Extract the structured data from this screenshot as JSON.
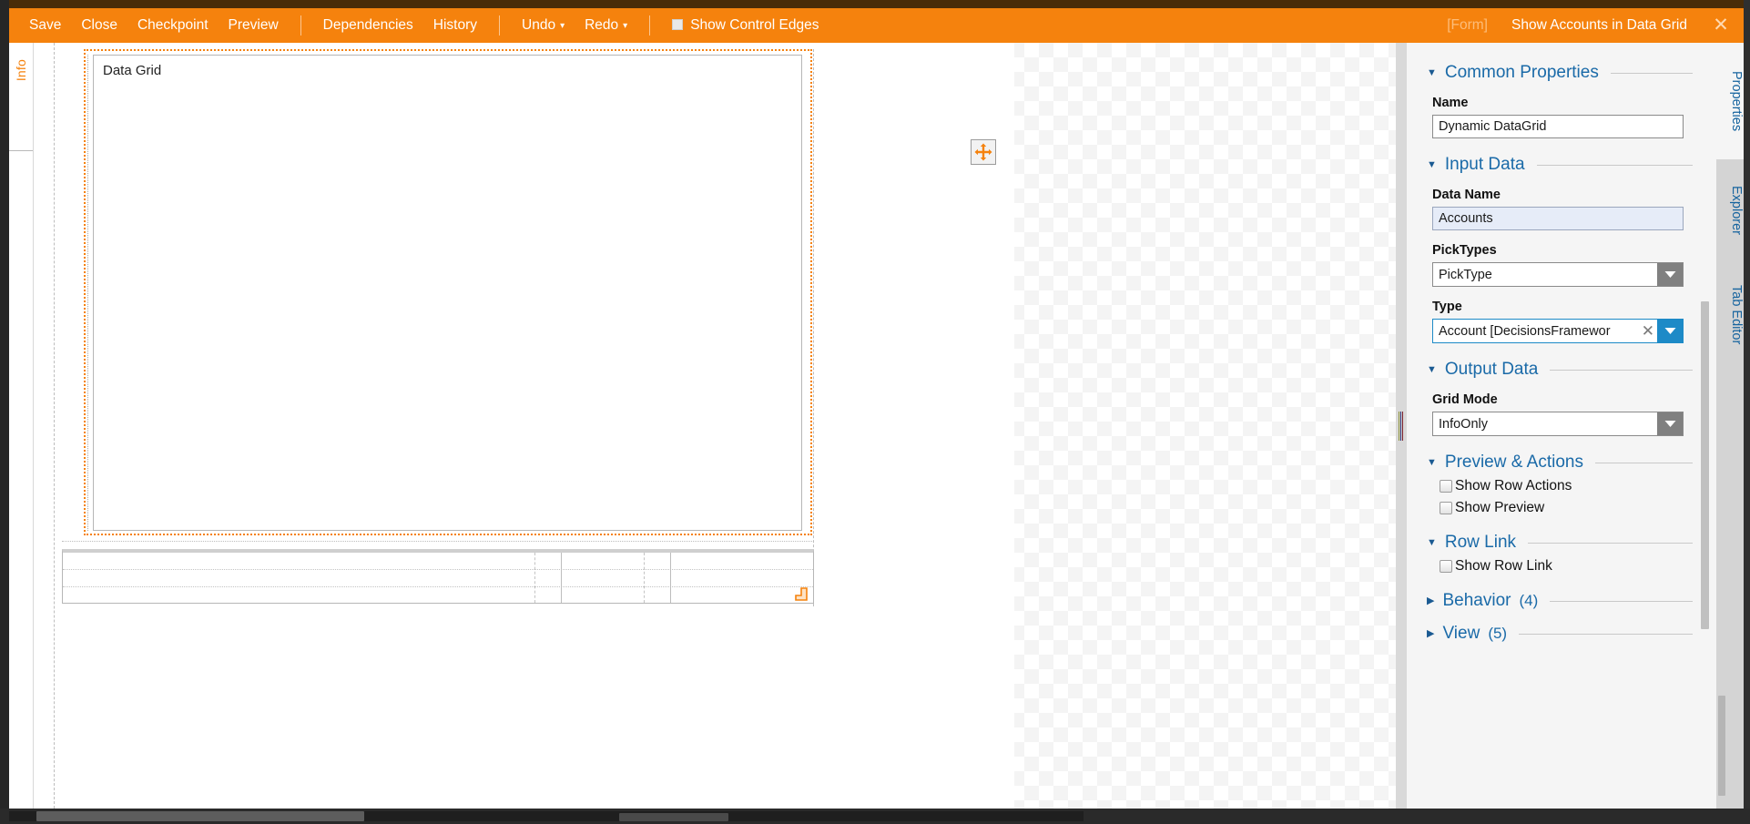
{
  "toolbar": {
    "items": [
      {
        "label": "Save",
        "name": "save"
      },
      {
        "label": "Close",
        "name": "close"
      },
      {
        "label": "Checkpoint",
        "name": "checkpoint"
      },
      {
        "label": "Preview",
        "name": "preview"
      },
      {
        "label": "Dependencies",
        "name": "dependencies"
      },
      {
        "label": "History",
        "name": "history"
      },
      {
        "label": "Undo",
        "name": "undo"
      },
      {
        "label": "Redo",
        "name": "redo"
      }
    ],
    "undo_label": "Undo",
    "redo_label": "Redo",
    "show_control_edges_label": "Show Control Edges",
    "show_control_edges_checked": false,
    "form_tag": "[Form]",
    "document_title": "Show Accounts in Data Grid",
    "close_glyph": "✕",
    "accent_color": "#f5820d"
  },
  "left_strip": {
    "info_tab_label": "Info"
  },
  "canvas": {
    "data_grid_label": "Data Grid",
    "move_handle_icon": "move-arrows-icon",
    "resize_handle_icon": "resize-corner-icon"
  },
  "properties": {
    "sections": {
      "common": {
        "title": "Common Properties",
        "expanded": true
      },
      "input": {
        "title": "Input Data",
        "expanded": true
      },
      "output": {
        "title": "Output Data",
        "expanded": true
      },
      "preview_actions": {
        "title": "Preview & Actions",
        "expanded": true
      },
      "row_link": {
        "title": "Row Link",
        "expanded": true
      },
      "behavior": {
        "title": "Behavior",
        "count": "(4)",
        "expanded": false
      },
      "view": {
        "title": "View",
        "count": "(5)",
        "expanded": false
      }
    },
    "name_label": "Name",
    "name_value": "Dynamic DataGrid",
    "data_name_label": "Data Name",
    "data_name_value": "Accounts",
    "picktypes_label": "PickTypes",
    "picktypes_value": "PickType",
    "type_label": "Type",
    "type_value": "Account   [DecisionsFramewor",
    "type_clear_glyph": "✕",
    "grid_mode_label": "Grid Mode",
    "grid_mode_value": "InfoOnly",
    "show_row_actions_label": "Show Row Actions",
    "show_row_actions_checked": false,
    "show_preview_label": "Show Preview",
    "show_preview_checked": false,
    "show_row_link_label": "Show Row Link",
    "show_row_link_checked": false,
    "header_color": "#1a6aa8",
    "focus_color": "#1d8ac7"
  },
  "right_tabs": [
    {
      "label": "Properties",
      "active": true
    },
    {
      "label": "Explorer",
      "active": false
    },
    {
      "label": "Tab Editor",
      "active": false
    }
  ]
}
